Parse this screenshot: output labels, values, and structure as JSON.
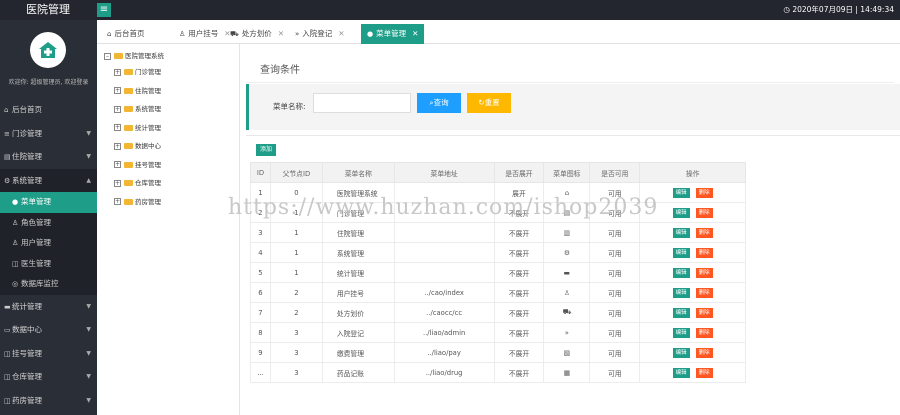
{
  "topbar": {
    "brand": "医院管理",
    "menu_toggle": "≡",
    "clock_icon": "clock-icon",
    "datetime": "2020年07月09日 | 14:49:34"
  },
  "sidebar": {
    "user_line": "欢迎你: 超级管理员, 欢迎登录",
    "items": [
      {
        "icon": "home-icon",
        "glyph": "⌂",
        "label": "后台首页",
        "arrow": ""
      },
      {
        "icon": "outpatient-icon",
        "glyph": "≡",
        "label": "门诊管理",
        "arrow": "▼"
      },
      {
        "icon": "hospital-icon",
        "glyph": "▤",
        "label": "住院管理",
        "arrow": "▼"
      },
      {
        "icon": "gear-icon",
        "glyph": "⚙",
        "label": "系统管理",
        "arrow": "▲"
      }
    ],
    "sub_items": [
      {
        "icon": "menu-icon",
        "glyph": "●",
        "label": "菜单管理"
      },
      {
        "icon": "role-icon",
        "glyph": "♙",
        "label": "角色管理"
      },
      {
        "icon": "user-icon",
        "glyph": "♙",
        "label": "用户管理"
      },
      {
        "icon": "doctor-icon",
        "glyph": "◫",
        "label": "医生管理"
      },
      {
        "icon": "database-icon",
        "glyph": "◎",
        "label": "数据库监控"
      }
    ],
    "items_after": [
      {
        "icon": "stats-icon",
        "glyph": "▬",
        "label": "统计管理",
        "arrow": "▼"
      },
      {
        "icon": "data-icon",
        "glyph": "▭",
        "label": "数据中心",
        "arrow": "▼"
      },
      {
        "icon": "register-icon",
        "glyph": "◫",
        "label": "挂号管理",
        "arrow": "▼"
      },
      {
        "icon": "warehouse-icon",
        "glyph": "◫",
        "label": "仓库管理",
        "arrow": "▼"
      },
      {
        "icon": "pharmacy-icon",
        "glyph": "◫",
        "label": "药房管理",
        "arrow": "▼"
      }
    ]
  },
  "tabs": [
    {
      "icon": "home-icon",
      "glyph": "⌂",
      "label": "后台首页",
      "close": ""
    },
    {
      "icon": "user-icon",
      "glyph": "♙",
      "label": "用户挂号",
      "close": "✕"
    },
    {
      "icon": "cart-icon",
      "glyph": "⛟",
      "label": "处方划价",
      "close": "✕"
    },
    {
      "icon": "forward-icon",
      "glyph": "»",
      "label": "入院登记",
      "close": "✕"
    },
    {
      "icon": "menu-icon",
      "glyph": "●",
      "label": "菜单管理",
      "close": "✕"
    }
  ],
  "tree": {
    "root": "医院管理系统",
    "root_toggle": "–",
    "children": [
      "门诊管理",
      "住院管理",
      "系统管理",
      "统计管理",
      "数据中心",
      "挂号管理",
      "仓库管理",
      "药房管理"
    ],
    "child_toggle": "+"
  },
  "search": {
    "title": "查询条件",
    "label": "菜单名称:",
    "placeholder": "",
    "query_icon": "search-icon",
    "query_label": "查询",
    "reset_icon": "refresh-icon",
    "reset_label": "重置"
  },
  "add_label": "添加",
  "table": {
    "columns": [
      "ID",
      "父节点ID",
      "菜单名称",
      "菜单地址",
      "是否展开",
      "菜单图标",
      "是否可用",
      "操作"
    ],
    "rows": [
      {
        "id": "1",
        "pid": "0",
        "name": "医院管理系统",
        "url": "",
        "open": "展开",
        "icon": "home-outline-icon",
        "glyph": "⌂",
        "available": "可用"
      },
      {
        "id": "2",
        "pid": "1",
        "name": "门诊管理",
        "url": "",
        "open": "不展开",
        "icon": "list-icon",
        "glyph": "▤",
        "available": "可用"
      },
      {
        "id": "3",
        "pid": "1",
        "name": "住院管理",
        "url": "",
        "open": "不展开",
        "icon": "bed-icon",
        "glyph": "▥",
        "available": "可用"
      },
      {
        "id": "4",
        "pid": "1",
        "name": "系统管理",
        "url": "",
        "open": "不展开",
        "icon": "gear-icon",
        "glyph": "⚙",
        "available": "可用"
      },
      {
        "id": "5",
        "pid": "1",
        "name": "统计管理",
        "url": "",
        "open": "不展开",
        "icon": "chat-icon",
        "glyph": "▬",
        "available": "可用"
      },
      {
        "id": "6",
        "pid": "2",
        "name": "用户挂号",
        "url": "../cao/index",
        "open": "不展开",
        "icon": "user-icon",
        "glyph": "♙",
        "available": "可用"
      },
      {
        "id": "7",
        "pid": "2",
        "name": "处方划价",
        "url": "../caocc/cc",
        "open": "不展开",
        "icon": "cart-icon",
        "glyph": "⛟",
        "available": "可用"
      },
      {
        "id": "8",
        "pid": "3",
        "name": "入院登记",
        "url": "../liao/admin",
        "open": "不展开",
        "icon": "forward-icon",
        "glyph": "»",
        "available": "可用"
      },
      {
        "id": "9",
        "pid": "3",
        "name": "缴费管理",
        "url": "../liao/pay",
        "open": "不展开",
        "icon": "card-icon",
        "glyph": "▧",
        "available": "可用"
      },
      {
        "id": "...",
        "pid": "3",
        "name": "药品记账",
        "url": "../liao/drug",
        "open": "不展开",
        "icon": "grid-icon",
        "glyph": "▦",
        "available": "可用"
      }
    ],
    "edit_label": "编辑",
    "delete_label": "删除"
  },
  "watermark": "https://www.huzhan.com/ishop2039",
  "colors": {
    "accent": "#1e9e88",
    "topbar": "#23262e",
    "sidebar": "#2a2e36",
    "query": "#1e9fff",
    "reset": "#ffb800",
    "delete": "#ff5722"
  }
}
